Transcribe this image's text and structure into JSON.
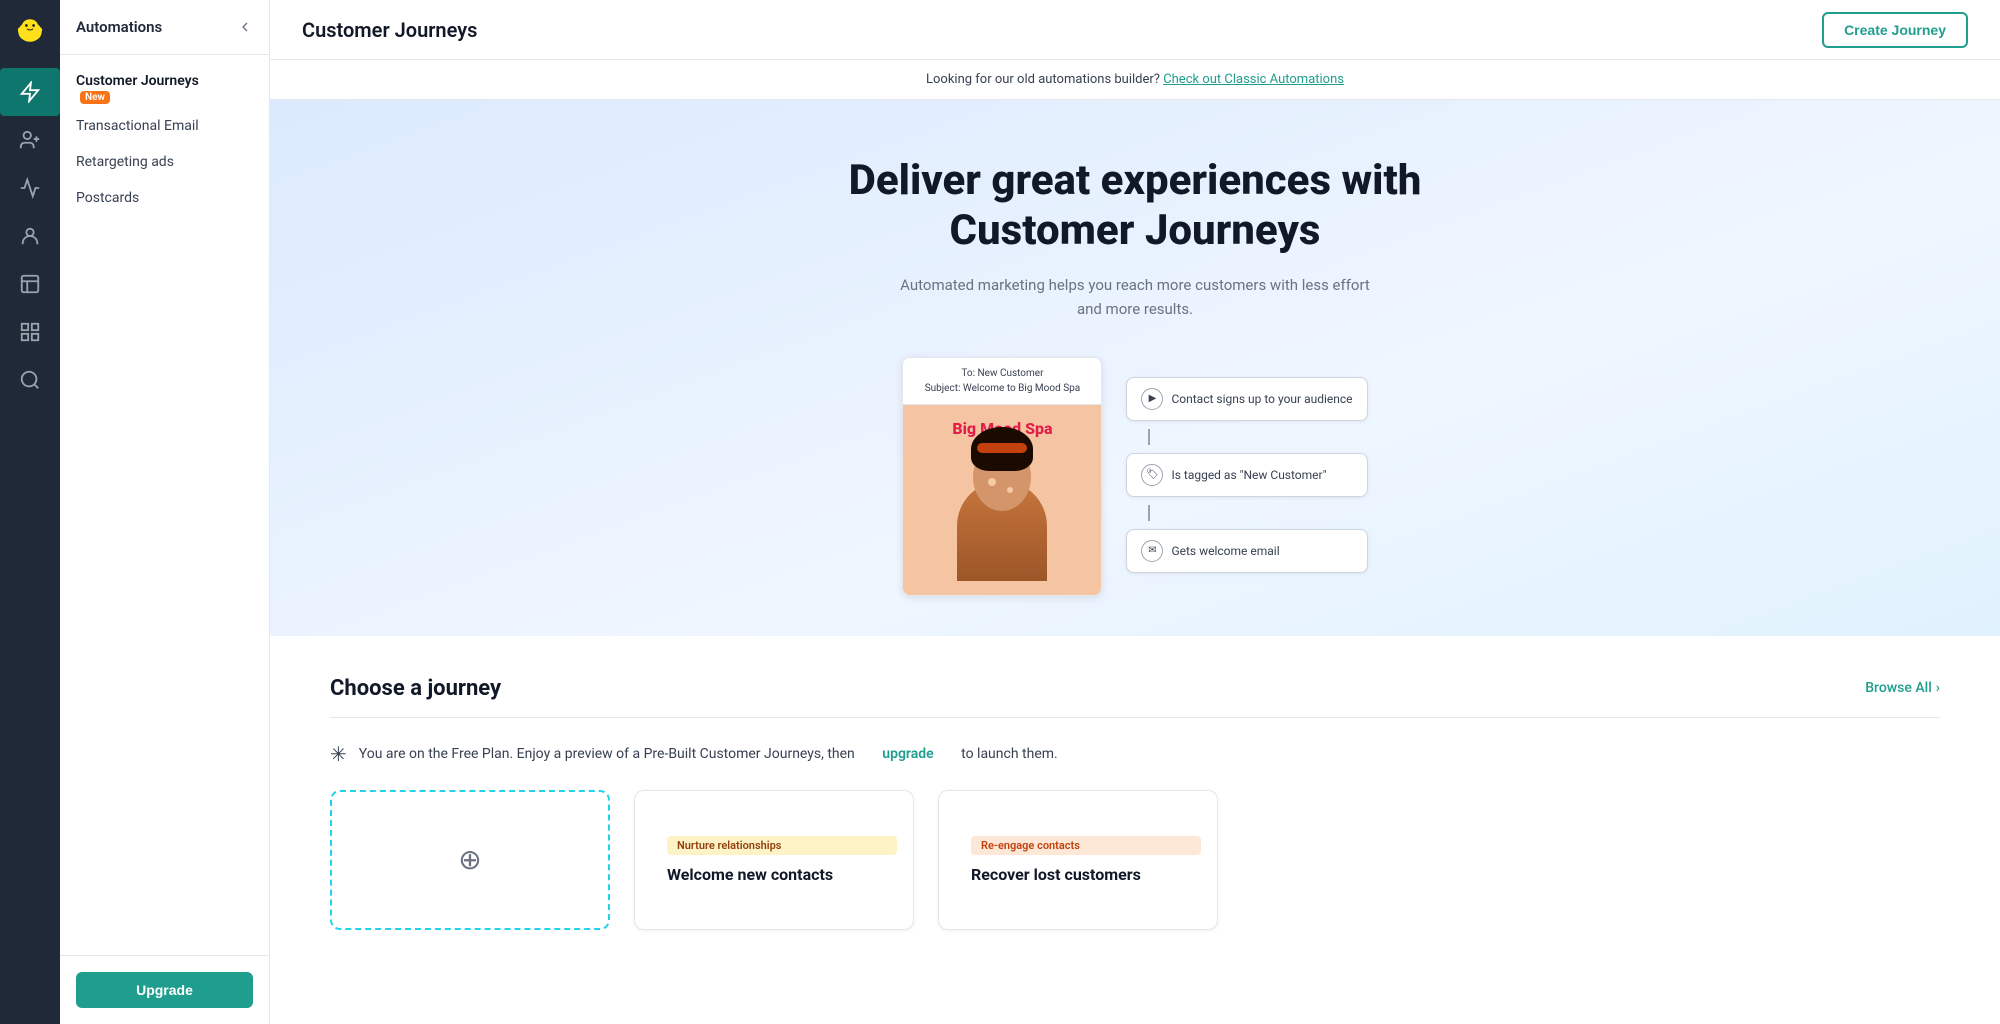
{
  "app": {
    "name": "Automations",
    "collapse_icon": "chevron-left"
  },
  "icon_sidebar": {
    "items": [
      {
        "id": "automations",
        "icon": "lightning",
        "active": true
      },
      {
        "id": "contacts",
        "icon": "users"
      },
      {
        "id": "analytics",
        "icon": "chart"
      },
      {
        "id": "audiences",
        "icon": "audience"
      },
      {
        "id": "templates",
        "icon": "template"
      },
      {
        "id": "integrations",
        "icon": "grid"
      },
      {
        "id": "search",
        "icon": "search"
      }
    ]
  },
  "nav_sidebar": {
    "title": "Automations",
    "items": [
      {
        "id": "customer-journeys",
        "label": "Customer Journeys",
        "active": true,
        "badge": "New"
      },
      {
        "id": "transactional-email",
        "label": "Transactional Email"
      },
      {
        "id": "retargeting-ads",
        "label": "Retargeting ads"
      },
      {
        "id": "postcards",
        "label": "Postcards"
      }
    ],
    "upgrade_button": "Upgrade"
  },
  "top_bar": {
    "title": "Customer Journeys",
    "create_button": "Create Journey"
  },
  "classic_banner": {
    "text": "Looking for our old automations builder?",
    "link_text": "Check out Classic Automations"
  },
  "hero": {
    "title": "Deliver great experiences with Customer Journeys",
    "subtitle": "Automated marketing helps you reach more customers with less effort and more results.",
    "email_preview": {
      "to": "To: New Customer",
      "subject": "Subject: Welcome to Big Mood Spa"
    },
    "spa_name": "Big Mood Spa",
    "steps": [
      {
        "label": "Contact signs up to your audience",
        "icon": "play"
      },
      {
        "label": "Is tagged as \"New Customer\"",
        "icon": "tag"
      },
      {
        "label": "Gets welcome email",
        "icon": "email"
      }
    ]
  },
  "choose_journey": {
    "title": "Choose a journey",
    "browse_all": "Browse All",
    "free_plan_notice": "You are on the Free Plan. Enjoy a preview of a Pre-Built Customer Journeys, then",
    "upgrade_link": "upgrade",
    "free_plan_suffix": "to launch them.",
    "cards": [
      {
        "id": "custom",
        "type": "custom",
        "label": ""
      },
      {
        "id": "welcome",
        "type": "template",
        "tag": "Nurture relationships",
        "tag_type": "nurture",
        "title": "Welcome new contacts"
      },
      {
        "id": "recover",
        "type": "template",
        "tag": "Re-engage contacts",
        "tag_type": "reengage",
        "title": "Recover lost customers"
      }
    ]
  }
}
